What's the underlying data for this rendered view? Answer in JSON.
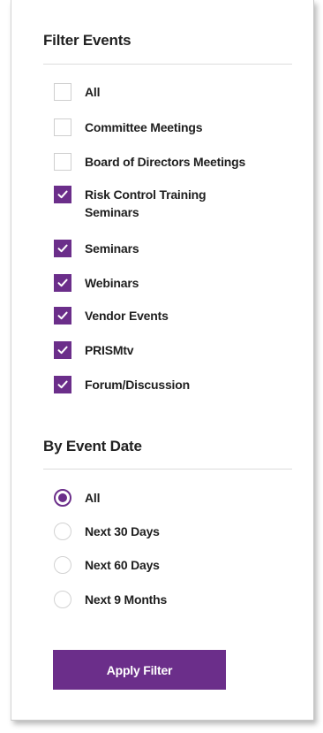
{
  "filter": {
    "title": "Filter Events",
    "items": [
      {
        "label": "All",
        "checked": false
      },
      {
        "label": "Committee Meetings",
        "checked": false
      },
      {
        "label": "Board of Directors Meetings",
        "checked": false
      },
      {
        "label": "Risk Control Training Seminars",
        "checked": true
      },
      {
        "label": "Seminars",
        "checked": true
      },
      {
        "label": "Webinars",
        "checked": true
      },
      {
        "label": "Vendor Events",
        "checked": true
      },
      {
        "label": "PRISMtv",
        "checked": true
      },
      {
        "label": "Forum/Discussion",
        "checked": true
      }
    ]
  },
  "date": {
    "title": "By Event Date",
    "options": [
      {
        "label": "All",
        "selected": true
      },
      {
        "label": "Next 30 Days",
        "selected": false
      },
      {
        "label": "Next 60 Days",
        "selected": false
      },
      {
        "label": "Next 9 Months",
        "selected": false
      }
    ]
  },
  "apply_label": "Apply Filter",
  "colors": {
    "accent": "#6b2e8a",
    "text": "#1f1f1f",
    "border": "#cfcfcf"
  },
  "icons": {
    "check": "checkmark-icon"
  }
}
